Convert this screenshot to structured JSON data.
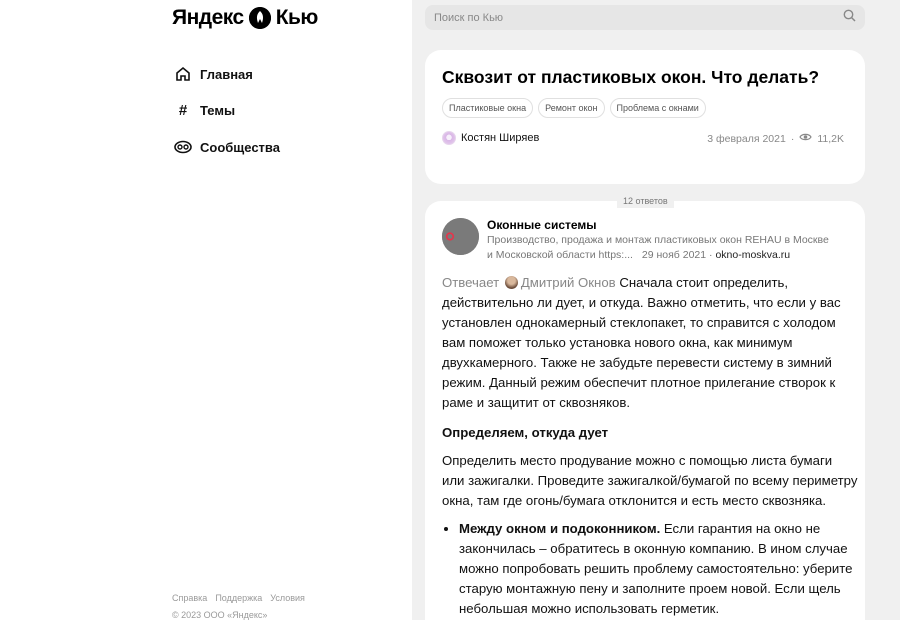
{
  "brand": {
    "logo_left": "Яндекс",
    "logo_right": "Кью"
  },
  "nav": [
    {
      "label": "Главная",
      "icon": "home-icon"
    },
    {
      "label": "Темы",
      "icon": "hash-icon"
    },
    {
      "label": "Сообщества",
      "icon": "community-icon"
    }
  ],
  "footer": {
    "links": [
      "Справка",
      "Поддержка",
      "Условия"
    ],
    "copyright": "© 2023 ООО «Яндекс»"
  },
  "search": {
    "placeholder": "Поиск по Кью"
  },
  "question": {
    "title": "Сквозит от пластиковых окон. Что делать?",
    "tags": [
      "Пластиковые окна",
      "Ремонт окон",
      "Проблема с окнами"
    ],
    "author": "Костян Ширяев",
    "date": "3 февраля 2021",
    "separator": "·",
    "views": "11,2K"
  },
  "answers_count": "12 ответов",
  "answer": {
    "org_name": "Оконные системы",
    "org_avatar_text": "Оконные системы",
    "org_description": "Производство, продажа и монтаж пластиковых окон REHAU в Москве и Московской области https:...",
    "date": "29 нояб 2021",
    "separator": "·",
    "site": "okno-moskva.ru",
    "answered_label": "Отвечает",
    "answerer": "Дмитрий Окнов",
    "intro": "Сначала стоит определить, действительно ли дует, и откуда. Важно отметить, что если у вас установлен однокамерный стеклопакет, то справится с холодом вам поможет только установка нового окна, как минимум двухкамерного. Также не забудьте перевести систему в зимний режим. Данный режим обеспечит плотное прилегание створок к раме и защитит от сквозняков.",
    "section_title": "Определяем, откуда дует",
    "section_text": "Определить место продувание можно с помощью листа бумаги или зажигалки. Проведите зажигалкой/бумагой по всему периметру окна, там где огонь/бумага отклонится и есть место сквозняка.",
    "bullet1_bold": "Между окном и подоконником.",
    "bullet1_text": " Если гарантия на окно не закончилась – обратитесь в оконную компанию. В ином случае можно попробовать решить проблему самостоятельно: уберите старую монтажную пену и заполните проем новой. Если щель небольшая можно использовать герметик."
  }
}
